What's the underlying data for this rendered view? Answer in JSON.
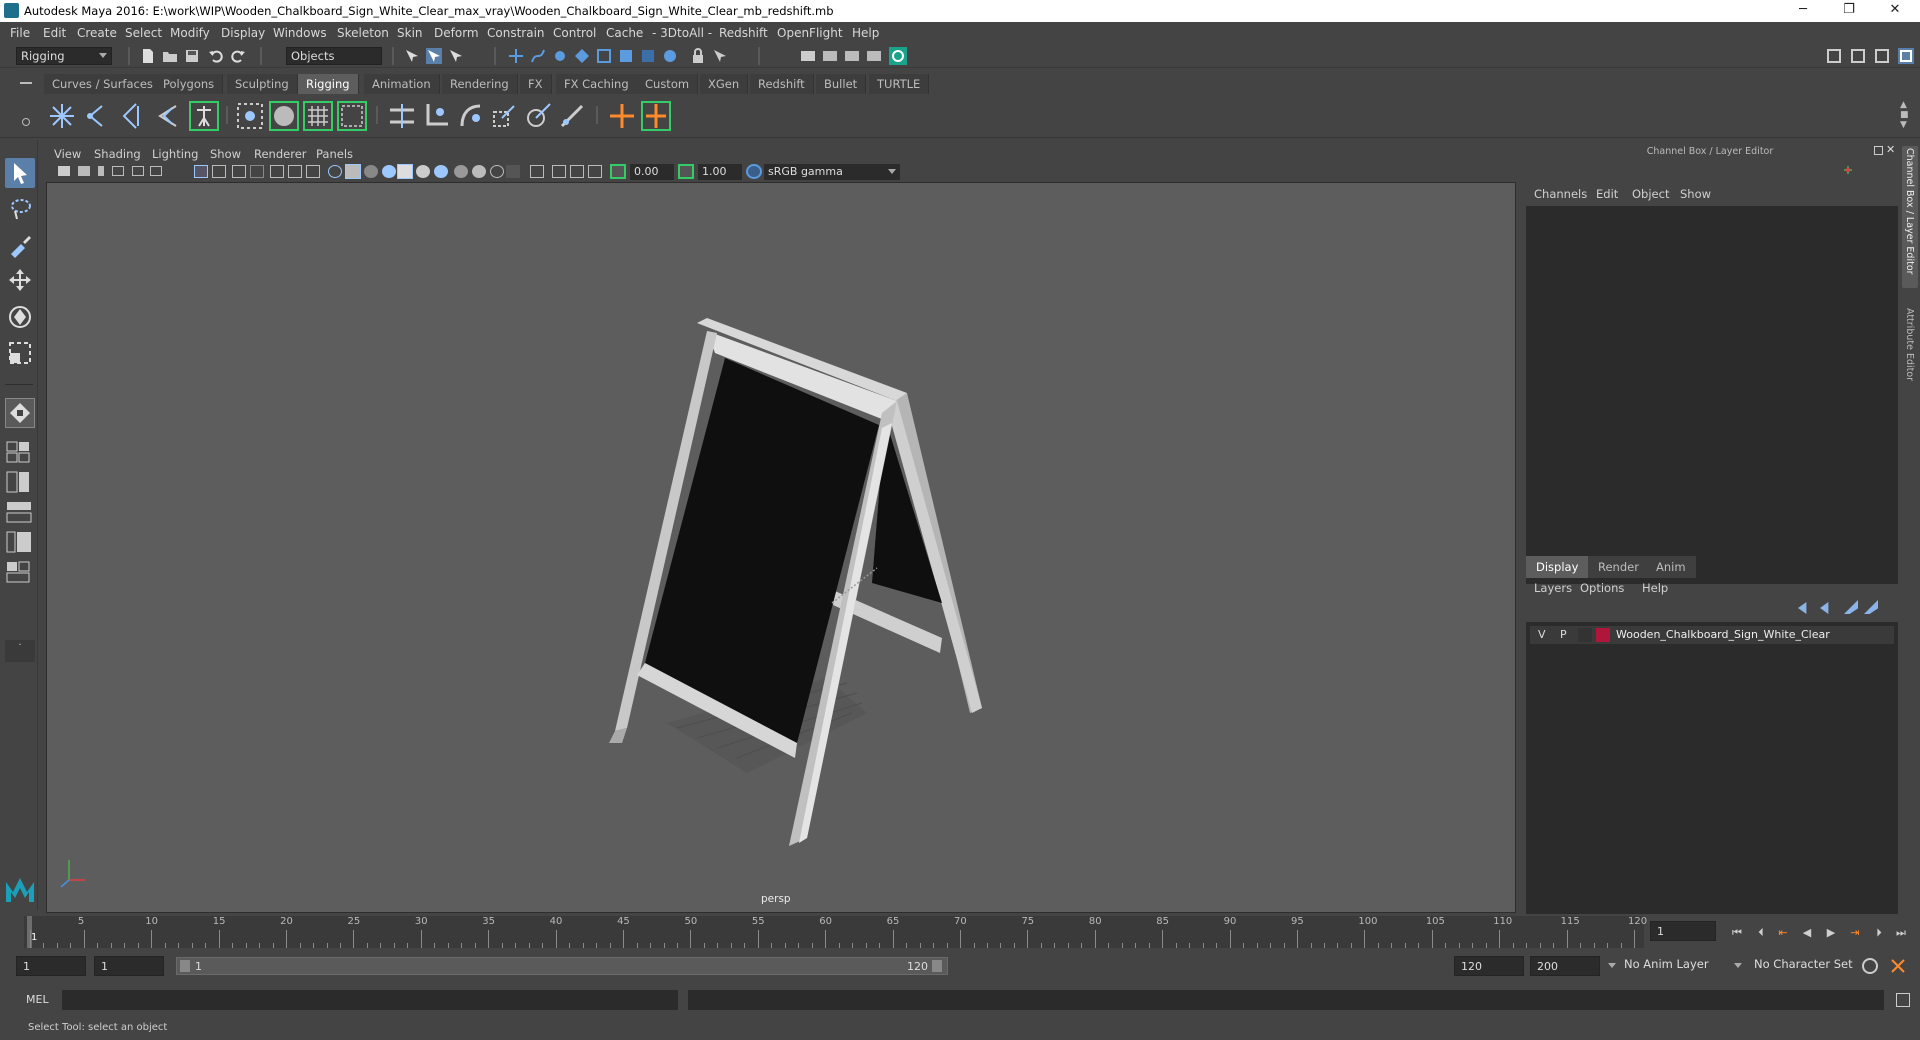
{
  "title_bar": {
    "title": "Autodesk Maya 2016: E:\\work\\WIP\\Wooden_Chalkboard_Sign_White_Clear_max_vray\\Wooden_Chalkboard_Sign_White_Clear_mb_redshift.mb",
    "minimize": "─",
    "restore": "❐",
    "close": "✕"
  },
  "menu_bar": {
    "items": [
      "File",
      "Edit",
      "Create",
      "Select",
      "Modify",
      "Display",
      "Windows",
      "Skeleton",
      "Skin",
      "Deform",
      "Constrain",
      "Control",
      "Cache",
      "- 3DtoAll -",
      "Redshift",
      "OpenFlight",
      "Help"
    ]
  },
  "status_line": {
    "menu_set": "Rigging",
    "selection_mode": "Objects"
  },
  "shelf": {
    "tabs": [
      "Curves / Surfaces",
      "Polygons",
      "Sculpting",
      "Rigging",
      "Animation",
      "Rendering",
      "FX",
      "FX Caching",
      "Custom",
      "XGen",
      "Redshift",
      "Bullet",
      "TURTLE"
    ],
    "active_tab": "Rigging"
  },
  "viewport": {
    "menus": [
      "View",
      "Shading",
      "Lighting",
      "Show",
      "Renderer",
      "Panels"
    ],
    "exposure": "0.00",
    "gamma": "1.00",
    "color_space": "sRGB gamma",
    "camera_label": "persp"
  },
  "channel_box": {
    "title": "Channel Box / Layer Editor",
    "menus": [
      "Channels",
      "Edit",
      "Object",
      "Show"
    ]
  },
  "layer_editor": {
    "tabs": [
      "Display",
      "Render",
      "Anim"
    ],
    "active_tab": "Display",
    "menus": [
      "Layers",
      "Options",
      "Help"
    ],
    "layers": [
      {
        "visible": "V",
        "playback": "P",
        "color": "#b0153a",
        "name": "Wooden_Chalkboard_Sign_White_Clear"
      }
    ]
  },
  "side_tabs": {
    "channel_box": "Channel Box / Layer Editor",
    "attribute_editor": "Attribute Editor"
  },
  "time_slider": {
    "tick_labels": [
      "1",
      "5",
      "10",
      "15",
      "20",
      "25",
      "30",
      "35",
      "40",
      "45",
      "50",
      "55",
      "60",
      "65",
      "70",
      "75",
      "80",
      "85",
      "90",
      "95",
      "100",
      "105",
      "110",
      "115",
      "120"
    ],
    "current_frame": "1"
  },
  "range_slider": {
    "start_time": "1",
    "playback_start": "1",
    "range_start_label": "1",
    "range_end_label": "120",
    "playback_end": "120",
    "end_time": "200",
    "anim_layer": "No Anim Layer",
    "character_set": "No Character Set"
  },
  "command_line": {
    "label": "MEL"
  },
  "help_line": {
    "text": "Select Tool: select an object"
  },
  "colors": {
    "accent_green": "#33cc66",
    "active_blue": "#5a7fa8",
    "layer_color": "#b0153a"
  }
}
